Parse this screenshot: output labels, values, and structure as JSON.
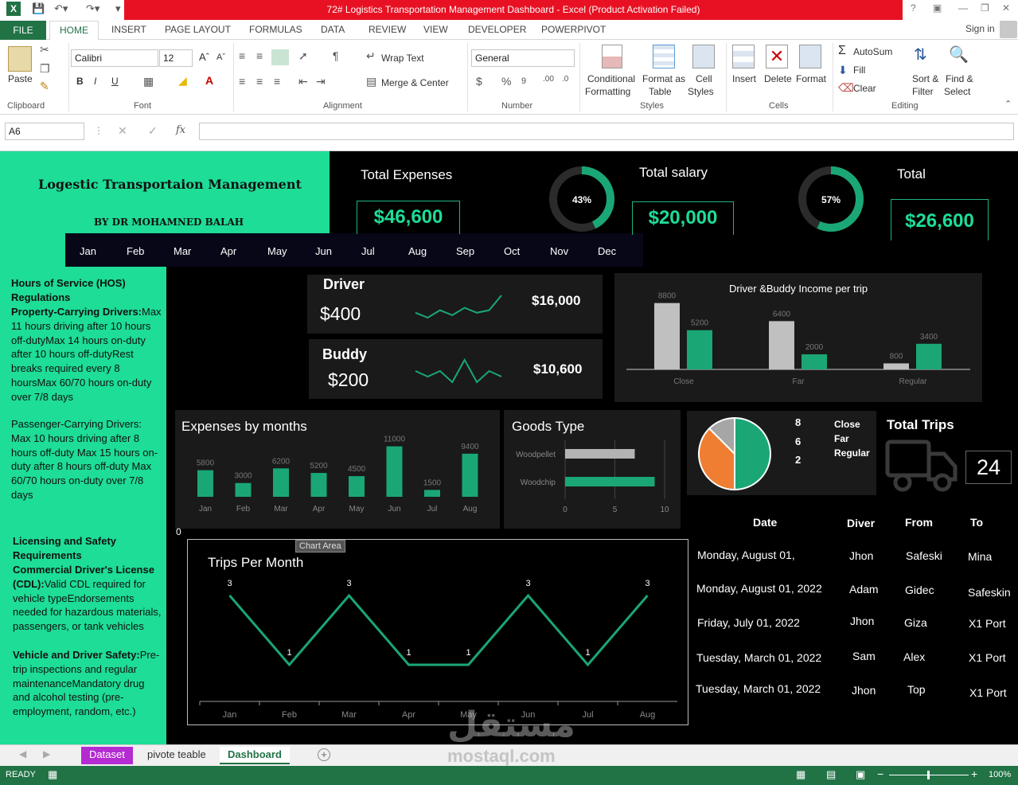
{
  "window": {
    "title": "72# Logistics Transportation Management Dashboard -  Excel (Product Activation Failed)",
    "sign_in": "Sign in"
  },
  "ribbon_tabs": [
    "FILE",
    "HOME",
    "INSERT",
    "PAGE LAYOUT",
    "FORMULAS",
    "DATA",
    "REVIEW",
    "VIEW",
    "DEVELOPER",
    "POWERPIVOT"
  ],
  "ribbon": {
    "clipboard": {
      "paste": "Paste",
      "group": "Clipboard"
    },
    "font": {
      "name": "Calibri",
      "size": "12",
      "group": "Font"
    },
    "alignment": {
      "wrap": "Wrap Text",
      "merge": "Merge & Center",
      "group": "Alignment"
    },
    "number": {
      "format": "General",
      "group": "Number"
    },
    "styles": {
      "cond1": "Conditional",
      "cond2": "Formatting",
      "fmt1": "Format as",
      "fmt2": "Table",
      "cell1": "Cell",
      "cell2": "Styles",
      "group": "Styles"
    },
    "cells": {
      "insert": "Insert",
      "delete": "Delete",
      "format": "Format",
      "group": "Cells"
    },
    "editing": {
      "autosum": "AutoSum",
      "fill": "Fill",
      "clear": "Clear",
      "sort1": "Sort &",
      "sort2": "Filter",
      "find1": "Find &",
      "find2": "Select",
      "group": "Editing"
    }
  },
  "formula_bar": {
    "name_box": "A6",
    "fx": "fx",
    "value": ""
  },
  "dashboard": {
    "title": "Logestic Transportaion Management",
    "author": "BY DR MOHAMNED  BALAH",
    "months": [
      "Jan",
      "Feb",
      "Mar",
      "Apr",
      "May",
      "Jun",
      "Jul",
      "Aug",
      "Sep",
      "Oct",
      "Nov",
      "Dec"
    ],
    "total_expenses": {
      "label": "Total Expenses",
      "value": "$46,600"
    },
    "total_salary": {
      "label": "Total salary",
      "value": "$20,000",
      "pct": "43%",
      "pct_value": 0.43
    },
    "total": {
      "label": "Total",
      "value": "$26,600",
      "pct": "57%",
      "pct_value": 0.57
    },
    "driver": {
      "label": "Driver",
      "rate": "$400",
      "total": "$16,000",
      "spark": [
        5,
        3,
        6,
        4,
        7,
        5,
        6,
        12
      ]
    },
    "buddy": {
      "label": "Buddy",
      "rate": "$200",
      "total": "$10,600",
      "spark": [
        6,
        5,
        6,
        4,
        8,
        4,
        6,
        5
      ]
    },
    "left_text": [
      {
        "bold": "Hours of Service (HOS) Regulations",
        "rest": ""
      },
      {
        "bold": "Property-Carrying Drivers:",
        "rest": "Max 11 hours driving after 10 hours off-dutyMax 14 hours on-duty after 10 hours off-dutyRest breaks required every 8 hoursMax 60/70 hours on-duty over 7/8 days"
      },
      {
        "bold": "Passenger-Carrying Drivers:",
        "rest": " Max 10 hours driving after 8 hours off-duty Max 15 hours on-duty after 8 hours off-duty Max 60/70 hours on-duty over 7/8 days"
      },
      {
        "bold": "Licensing and Safety Requirements",
        "rest": ""
      },
      {
        "bold": "Commercial Driver's License (CDL):",
        "rest": "Valid CDL required for vehicle typeEndorsements needed for hazardous materials, passengers, or tank vehicles"
      },
      {
        "bold": "Vehicle and Driver Safety:",
        "rest": "Pre-trip inspections and regular maintenanceMandatory drug and alcohol testing (pre-employment, random, etc.)"
      }
    ],
    "total_trips": {
      "label": "Total Trips",
      "value": "24"
    },
    "pie_legend": {
      "numbers": [
        "8",
        "6",
        "2"
      ],
      "labels": [
        "Close",
        "Far",
        "Regular"
      ]
    },
    "zero_label": "0",
    "chart_area_tooltip": "Chart Area",
    "trips_table": {
      "headers": [
        "Date",
        "Diver",
        "From",
        "To"
      ],
      "rows": [
        [
          "Monday, August 01,",
          "Jhon",
          "Safeski",
          "Mina"
        ],
        [
          "Monday, August 01, 2022",
          "Adam",
          "Gidec",
          "Safeskin"
        ],
        [
          "Friday, July 01, 2022",
          "Jhon",
          "Giza",
          "X1 Port"
        ],
        [
          "Tuesday, March 01, 2022",
          "Sam",
          "Alex",
          "X1 Port"
        ],
        [
          "Tuesday, March 01, 2022",
          "Jhon",
          "Top",
          "X1 Port"
        ]
      ]
    }
  },
  "chart_data": [
    {
      "type": "bar",
      "title": "Driver &Buddy Income per trip",
      "categories": [
        "Close",
        "Far",
        "Regular"
      ],
      "series": [
        {
          "values": [
            8800,
            6400,
            800
          ],
          "color": "#c0c0c0"
        },
        {
          "values": [
            5200,
            2000,
            3400
          ],
          "color": "#1aa775"
        }
      ],
      "ylim": [
        0,
        9500
      ]
    },
    {
      "type": "bar",
      "title": "Expenses by months",
      "categories": [
        "Jan",
        "Feb",
        "Mar",
        "Apr",
        "May",
        "Jun",
        "Jul",
        "Aug"
      ],
      "values": [
        5800,
        3000,
        6200,
        5200,
        4500,
        11000,
        1500,
        9400
      ],
      "ylim": [
        0,
        12500
      ],
      "color": "#1aa775"
    },
    {
      "type": "bar",
      "orientation": "horizontal",
      "title": "Goods Type",
      "categories": [
        "Woodpellet",
        "Woodchip"
      ],
      "values": [
        7,
        9
      ],
      "colors": [
        "#b3b3b3",
        "#1aa775"
      ],
      "xlim": [
        0,
        10
      ],
      "xticks": [
        "0",
        "5",
        "10"
      ]
    },
    {
      "type": "pie",
      "categories": [
        "Close",
        "Far",
        "Regular"
      ],
      "values": [
        8,
        6,
        2
      ],
      "colors": [
        "#1aa775",
        "#ef7e32",
        "#a6a6a6"
      ]
    },
    {
      "type": "line",
      "title": "Trips Per Month",
      "categories": [
        "Jan",
        "Feb",
        "Mar",
        "Apr",
        "May",
        "Jun",
        "Jul",
        "Aug"
      ],
      "values": [
        3,
        1,
        3,
        1,
        1,
        3,
        1,
        3
      ],
      "ylim": [
        0.3,
        3.3
      ],
      "color": "#1aa775"
    }
  ],
  "sheet_tabs": [
    "Dataset",
    "pivote teable",
    "Dashboard"
  ],
  "status": {
    "ready": "READY",
    "zoom": "100%"
  },
  "watermark": {
    "arabic": "مستقل",
    "latin": "mostaql.com"
  }
}
